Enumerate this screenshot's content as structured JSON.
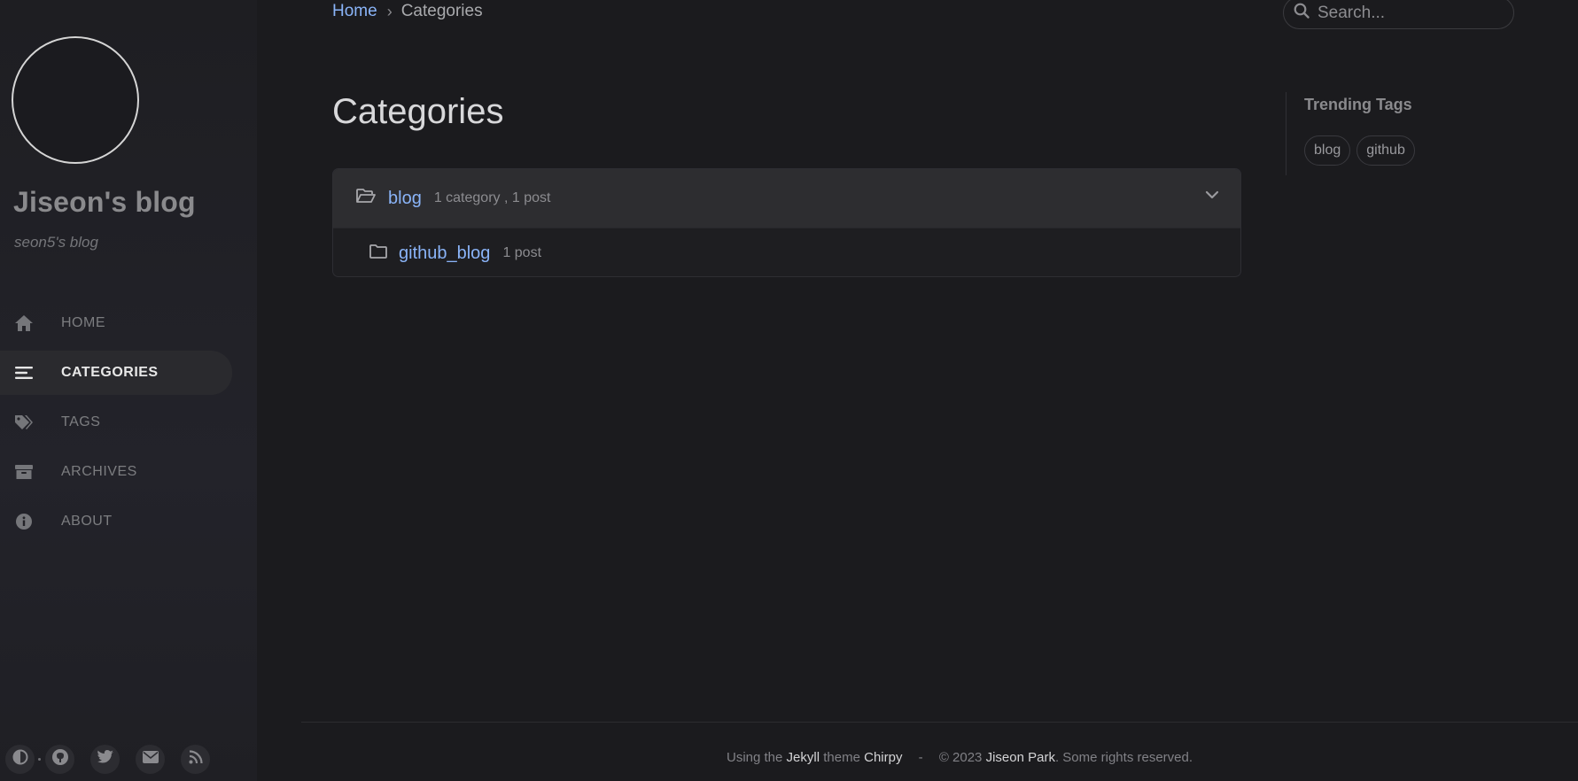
{
  "sidebar": {
    "site_title": "Jiseon's blog",
    "site_subtitle": "seon5's blog",
    "nav": [
      {
        "label": "HOME",
        "icon": "home-icon"
      },
      {
        "label": "CATEGORIES",
        "icon": "stream-icon",
        "active": true
      },
      {
        "label": "TAGS",
        "icon": "tags-icon"
      },
      {
        "label": "ARCHIVES",
        "icon": "archive-icon"
      },
      {
        "label": "ABOUT",
        "icon": "info-circle-icon"
      }
    ],
    "bottom_icons": [
      "theme-toggle-icon",
      "github-icon",
      "twitter-icon",
      "email-icon",
      "rss-icon"
    ]
  },
  "topbar": {
    "breadcrumb_home": "Home",
    "breadcrumb_sep": "›",
    "breadcrumb_current": "Categories",
    "search_placeholder": "Search..."
  },
  "main": {
    "title": "Categories",
    "category": {
      "name": "blog",
      "meta": "1 category , 1 post",
      "subcategory": {
        "name": "github_blog",
        "meta": "1 post"
      }
    }
  },
  "trending": {
    "title": "Trending Tags",
    "tags": [
      "blog",
      "github"
    ]
  },
  "footer": {
    "using_the": "Using the",
    "jekyll": "Jekyll",
    "theme": "theme",
    "chirpy": "Chirpy",
    "dash": "-",
    "copyright": "© 2023",
    "author": "Jiseon Park",
    "rights": ". Some rights reserved."
  },
  "colors": {
    "link": "#8ab4f8",
    "background": "#1b1b1e",
    "sidebar": "#1e1e22"
  }
}
